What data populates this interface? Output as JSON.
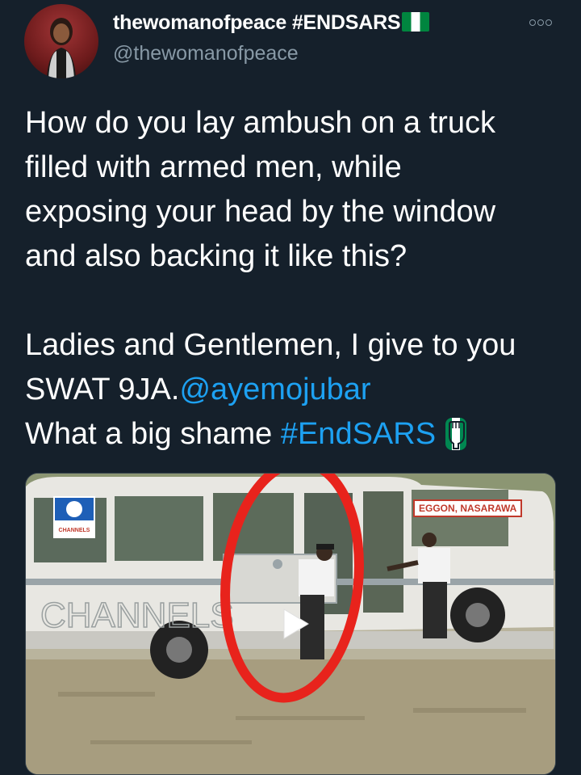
{
  "author": {
    "display_name": "thewomanofpeace #ENDSARS",
    "handle": "@thewomanofpeace"
  },
  "icons": {
    "more": "more-options-icon",
    "flag": "nigeria-flag-icon",
    "fist": "raised-fist-icon",
    "play": "play-icon"
  },
  "tweet": {
    "lines": [
      "How do you lay ambush on a truck",
      "filled with armed men, while",
      "exposing your head by the window",
      "and also backing it like this?",
      "Ladies and Gentlemen, I give to you"
    ],
    "line6_text": "SWAT 9JA.",
    "mention": "@ayemojubar",
    "line7_text": "What a big shame ",
    "hashtag": "#EndSARS"
  },
  "media": {
    "location_tag": "EGGON, NASARAWA",
    "channel_logo": "CHANNELS",
    "watermark": "CHANNELS"
  },
  "colors": {
    "background": "#15202b",
    "link": "#1da1f2",
    "secondary_text": "#8899a6"
  }
}
